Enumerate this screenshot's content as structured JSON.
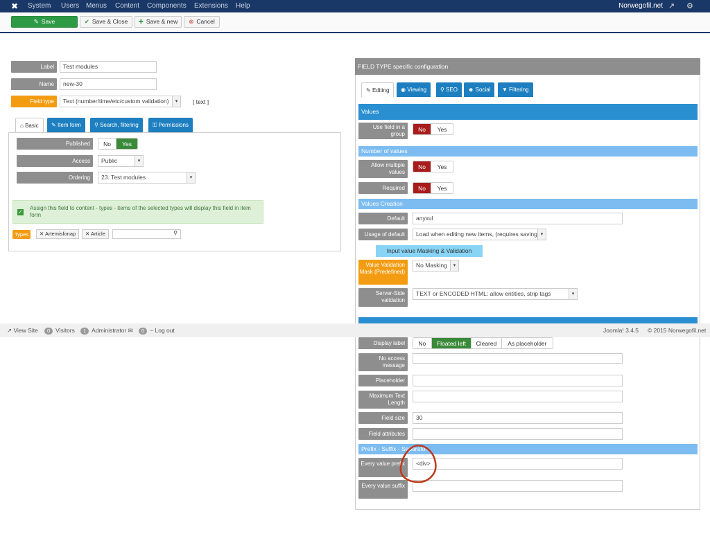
{
  "topbar": {
    "menu": [
      "System",
      "Users",
      "Menus",
      "Content",
      "Components",
      "Extensions",
      "Help"
    ],
    "site_name": "Norwegofil.net"
  },
  "toolbar": {
    "save": "Save",
    "save_close": "Save & Close",
    "save_new": "Save & new",
    "cancel": "Cancel"
  },
  "left": {
    "label_label": "Label",
    "label_value": "Test modules",
    "name_label": "Name",
    "name_value": "new-30",
    "field_type_label": "Field type",
    "field_type_value": "Text (number/time/etc/custom validation)",
    "field_type_tag": "[ text ]",
    "tabs": [
      "Basic",
      "Item form",
      "Search, filtering",
      "Permissions"
    ],
    "published_label": "Published",
    "published_no": "No",
    "published_yes": "Yes",
    "access_label": "Access",
    "access_value": "Public",
    "ordering_label": "Ordering",
    "ordering_value": "23. Test modules",
    "assign_text": "Assign this field to content - types - items of the selected types will display this field in item form",
    "types_label": "Types",
    "type_tags": [
      "Artemisfonap",
      "Article"
    ]
  },
  "right": {
    "header": "FIELD TYPE specific configuration",
    "tabs": [
      "Editing",
      "Viewing",
      "SEO",
      "Social",
      "Filtering"
    ],
    "values_header": "Values",
    "use_field_group_label": "Use field in a group",
    "num_values_header": "Number of values",
    "allow_multiple_label": "Allow multiple values",
    "required_label": "Required",
    "no": "No",
    "yes": "Yes",
    "values_creation_header": "Values Creation",
    "default_label": "Default",
    "default_value": "anyxul",
    "usage_default_label": "Usage of default",
    "usage_default_value": "Load when editing new items, (requires saving)",
    "masking_header": "Input value Masking & Validation",
    "validation_mask_label": "Value Validation Mask (Predefined)",
    "validation_mask_value": "No Masking",
    "server_validation_label": "Server-Side validation",
    "server_validation_value": "TEXT or ENCODED HTML: allow entities, strip tags",
    "display_label_label": "Display label",
    "display_opts": [
      "No",
      "Floated left",
      "Cleared",
      "As placeholder"
    ],
    "no_access_label": "No access message",
    "placeholder_label": "Placeholder",
    "max_text_label": "Maximum Text Length",
    "field_size_label": "Field size",
    "field_size_value": "30",
    "field_attributes_label": "Field attributes",
    "prefix_header": "Prefix - Suffix - Separator",
    "prefix_label": "Every value prefix",
    "prefix_value": "<div>",
    "suffix_label": "Every value suffix"
  },
  "footer": {
    "view_site": "View Site",
    "visitors_count": "0",
    "visitors": "Visitors",
    "admin_count": "1",
    "admin": "Administrator",
    "msg_count": "0",
    "logout": "Log out",
    "version": "Joomla! 3.4.5",
    "copyright": "© 2015 Norwegofil.net"
  },
  "colors": {
    "topbar": "#1a3867",
    "accent": "#2a8fd0",
    "orange": "#f39c12",
    "green": "#2f9a46",
    "red": "#a91c1c"
  }
}
